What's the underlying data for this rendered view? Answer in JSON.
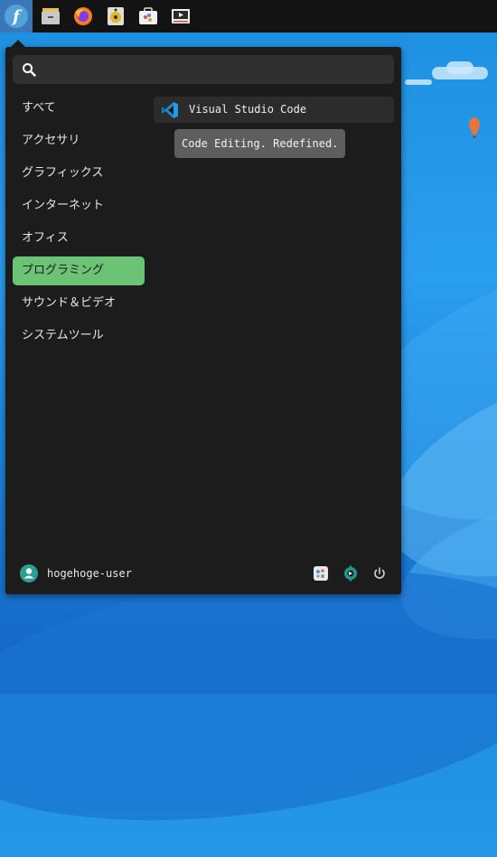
{
  "colors": {
    "accent": "#6cc375",
    "menu_bg": "#1c1c1c",
    "panel_bg": "#131313"
  },
  "taskbar": {
    "launcher_icon": "fedora-logo-icon",
    "launcher_glyph": "f",
    "apps": [
      "file-manager-icon",
      "firefox-icon",
      "rhythmbox-icon",
      "software-icon",
      "video-player-icon"
    ]
  },
  "search": {
    "value": "",
    "placeholder": ""
  },
  "categories": [
    {
      "label": "すべて"
    },
    {
      "label": "アクセサリ"
    },
    {
      "label": "グラフィックス"
    },
    {
      "label": "インターネット"
    },
    {
      "label": "オフィス"
    },
    {
      "label": "プログラミング",
      "active": true
    },
    {
      "label": "サウンド＆ビデオ"
    },
    {
      "label": "システムツール"
    }
  ],
  "apps": [
    {
      "name": "Visual Studio Code",
      "icon": "vscode-icon",
      "tooltip": "Code Editing. Redefined."
    }
  ],
  "footer": {
    "username": "hogehoge-user",
    "buttons": [
      "settings-icon",
      "software-center-icon",
      "power-icon"
    ]
  }
}
